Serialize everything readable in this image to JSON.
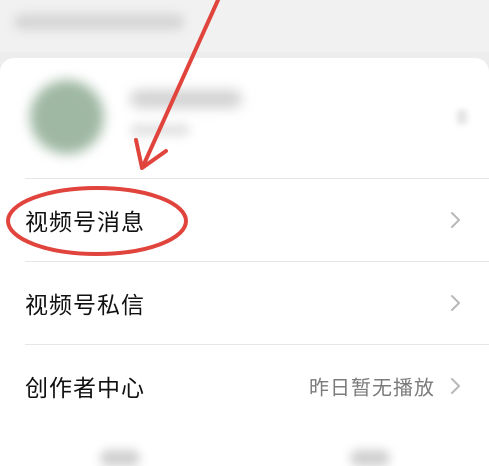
{
  "menu": {
    "items": [
      {
        "label": "视频号消息",
        "value": "",
        "icon": "chevron-right-icon"
      },
      {
        "label": "视频号私信",
        "value": "",
        "icon": "chevron-right-icon"
      },
      {
        "label": "创作者中心",
        "value": "昨日暂无播放",
        "icon": "chevron-right-icon"
      }
    ]
  },
  "annotation": {
    "color": "#e0443c",
    "shapes": [
      "arrow-annotation",
      "circle-highlight-annotation"
    ]
  },
  "colors": {
    "background": "#ededed",
    "card": "#ffffff",
    "label_text": "#111111",
    "value_text": "#7b7b7b",
    "chevron": "#b8b8b8"
  }
}
